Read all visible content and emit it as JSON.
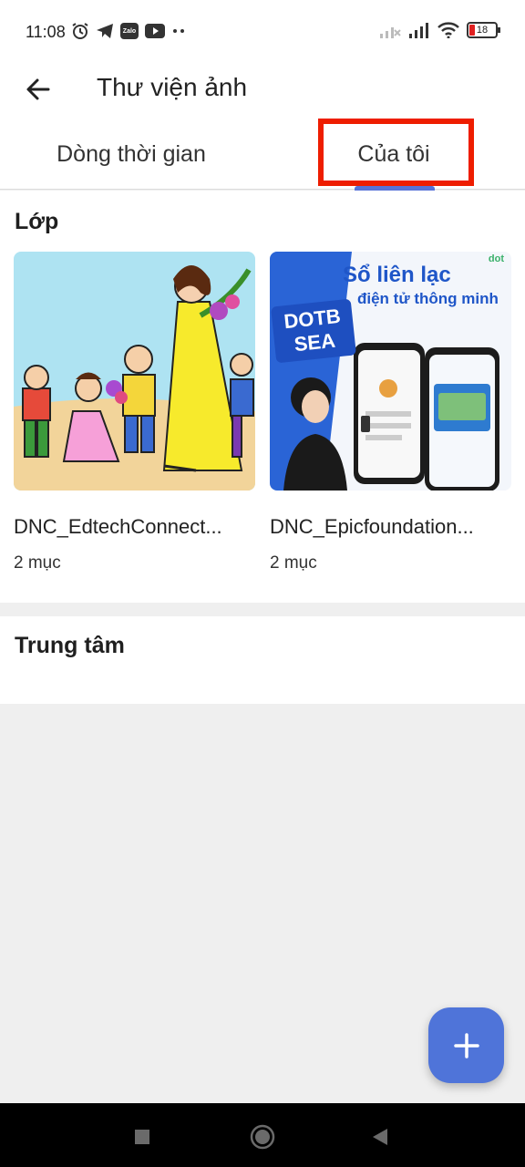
{
  "status_bar": {
    "time": "11:08",
    "left_icons": [
      "alarm-icon",
      "telegram-icon",
      "zalo-icon",
      "youtube-icon",
      "more-dots-icon"
    ],
    "zalo_label": "Zalo",
    "battery": "18"
  },
  "app_bar": {
    "title": "Thư viện ảnh"
  },
  "tabs": [
    {
      "label": "Dòng thời gian"
    },
    {
      "label": "Của tôi",
      "selected": true
    }
  ],
  "colors": {
    "accent": "#4f74d9",
    "highlight_box": "#ee1d00"
  },
  "sections": {
    "classes": {
      "title": "Lớp",
      "albums": [
        {
          "name": "DNC_EdtechConnect...",
          "count": "2 mục"
        },
        {
          "name": "DNC_Epicfoundation...",
          "count": "2 mục"
        }
      ]
    },
    "center": {
      "title": "Trung tâm"
    }
  },
  "album2_graphic": {
    "brand": "dot",
    "headline": "Sổ liên lạc",
    "subline": "điện tử thông minh",
    "badge_line1": "DOTB",
    "badge_line2": "SEA"
  }
}
